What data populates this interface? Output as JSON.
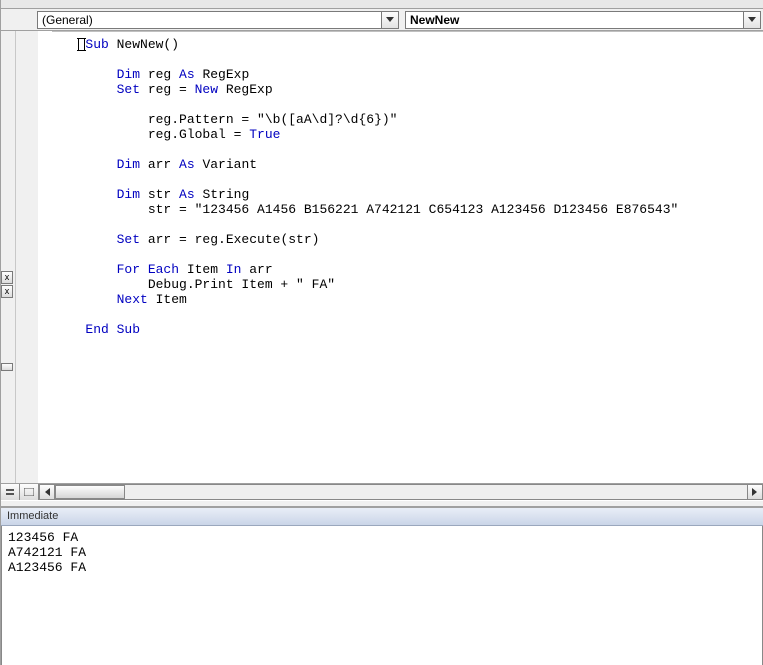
{
  "dropdowns": {
    "object": "(General)",
    "procedure": "NewNew"
  },
  "edgeButtons": {
    "close1": "x",
    "close2": "x"
  },
  "code": {
    "l1": "Sub",
    "l1b": " NewNew()",
    "l2": "Dim",
    "l2b": " reg ",
    "l2c": "As",
    "l2d": " RegExp",
    "l3": "Set",
    "l3b": " reg = ",
    "l3c": "New",
    "l3d": " RegExp",
    "l4a": "        reg.Pattern = ",
    "l4s": "\"\\b([aA\\d]?\\d{6})\"",
    "l5a": "        reg.Global = ",
    "l5b": "True",
    "l6": "Dim",
    "l6b": " arr ",
    "l6c": "As",
    "l6d": " Variant",
    "l7": "Dim",
    "l7b": " str ",
    "l7c": "As",
    "l7d": " String",
    "l8a": "    str = ",
    "l8s": "\"123456 A1456 B156221 A742121 C654123 A123456 D123456 E876543\"",
    "l9": "Set",
    "l9b": " arr = reg.Execute(str)",
    "l10": "For Each",
    "l10b": " Item ",
    "l10c": "In",
    "l10d": " arr",
    "l11a": "    Debug.Print Item + ",
    "l11s": "\" FA\"",
    "l12": "Next",
    "l12b": " Item",
    "l13": "End Sub"
  },
  "immediate": {
    "title": "Immediate",
    "lines": {
      "o1": "123456 FA",
      "o2": "A742121 FA",
      "o3": "A123456 FA"
    }
  }
}
